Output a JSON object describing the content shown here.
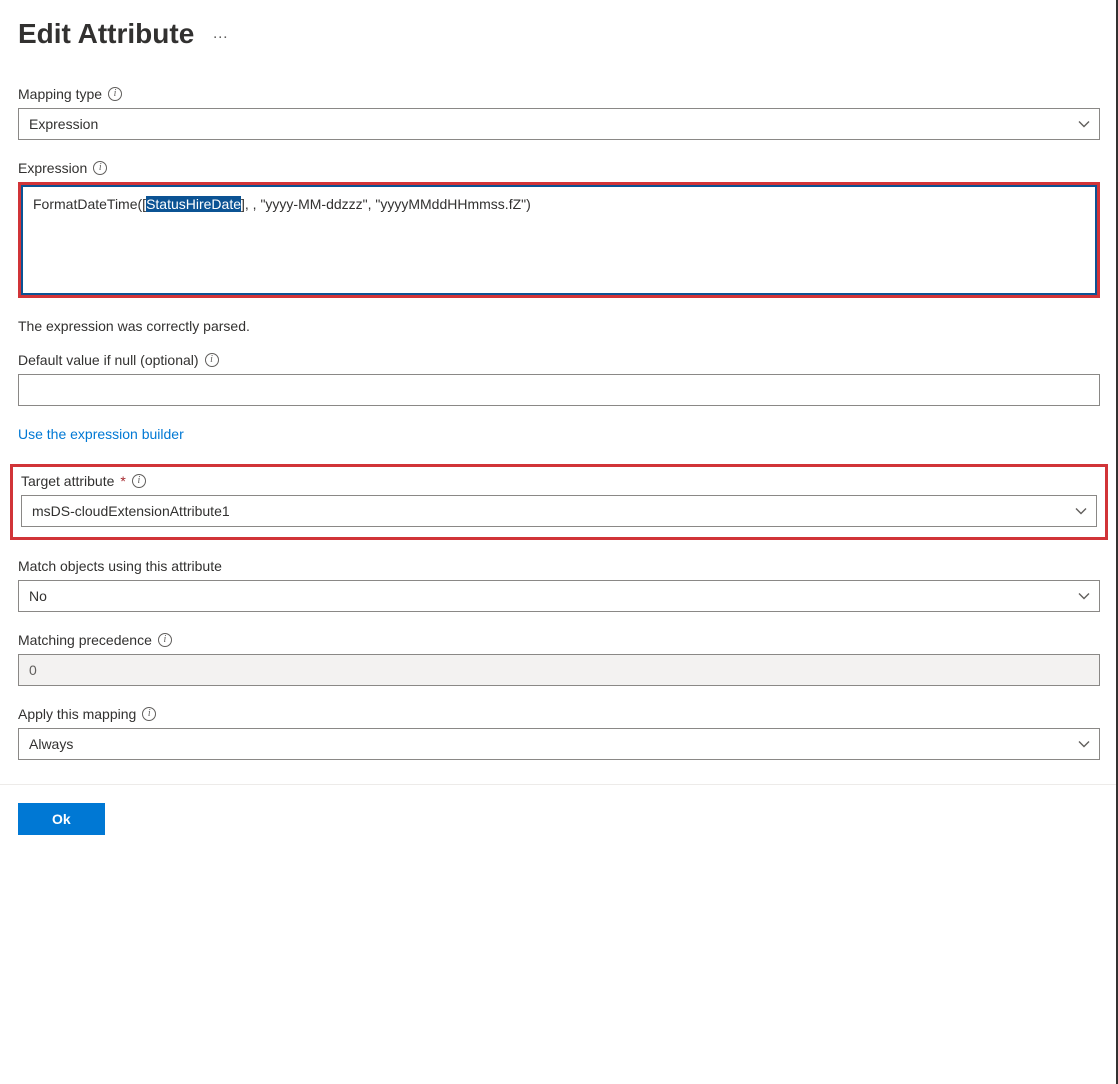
{
  "header": {
    "title": "Edit Attribute",
    "more": "…"
  },
  "fields": {
    "mappingType": {
      "label": "Mapping type",
      "value": "Expression"
    },
    "expression": {
      "label": "Expression",
      "prefix": "FormatDateTime([",
      "highlight": "StatusHireDate",
      "suffix": "], , \"yyyy-MM-ddzzz\", \"yyyyMMddHHmmss.fZ\")"
    },
    "parseStatus": "The expression was correctly parsed.",
    "defaultValue": {
      "label": "Default value if null (optional)",
      "value": ""
    },
    "builderLink": "Use the expression builder",
    "targetAttribute": {
      "label": "Target attribute",
      "value": "msDS-cloudExtensionAttribute1"
    },
    "matchObjects": {
      "label": "Match objects using this attribute",
      "value": "No"
    },
    "matchingPrecedence": {
      "label": "Matching precedence",
      "value": "0"
    },
    "applyMapping": {
      "label": "Apply this mapping",
      "value": "Always"
    }
  },
  "buttons": {
    "ok": "Ok"
  }
}
